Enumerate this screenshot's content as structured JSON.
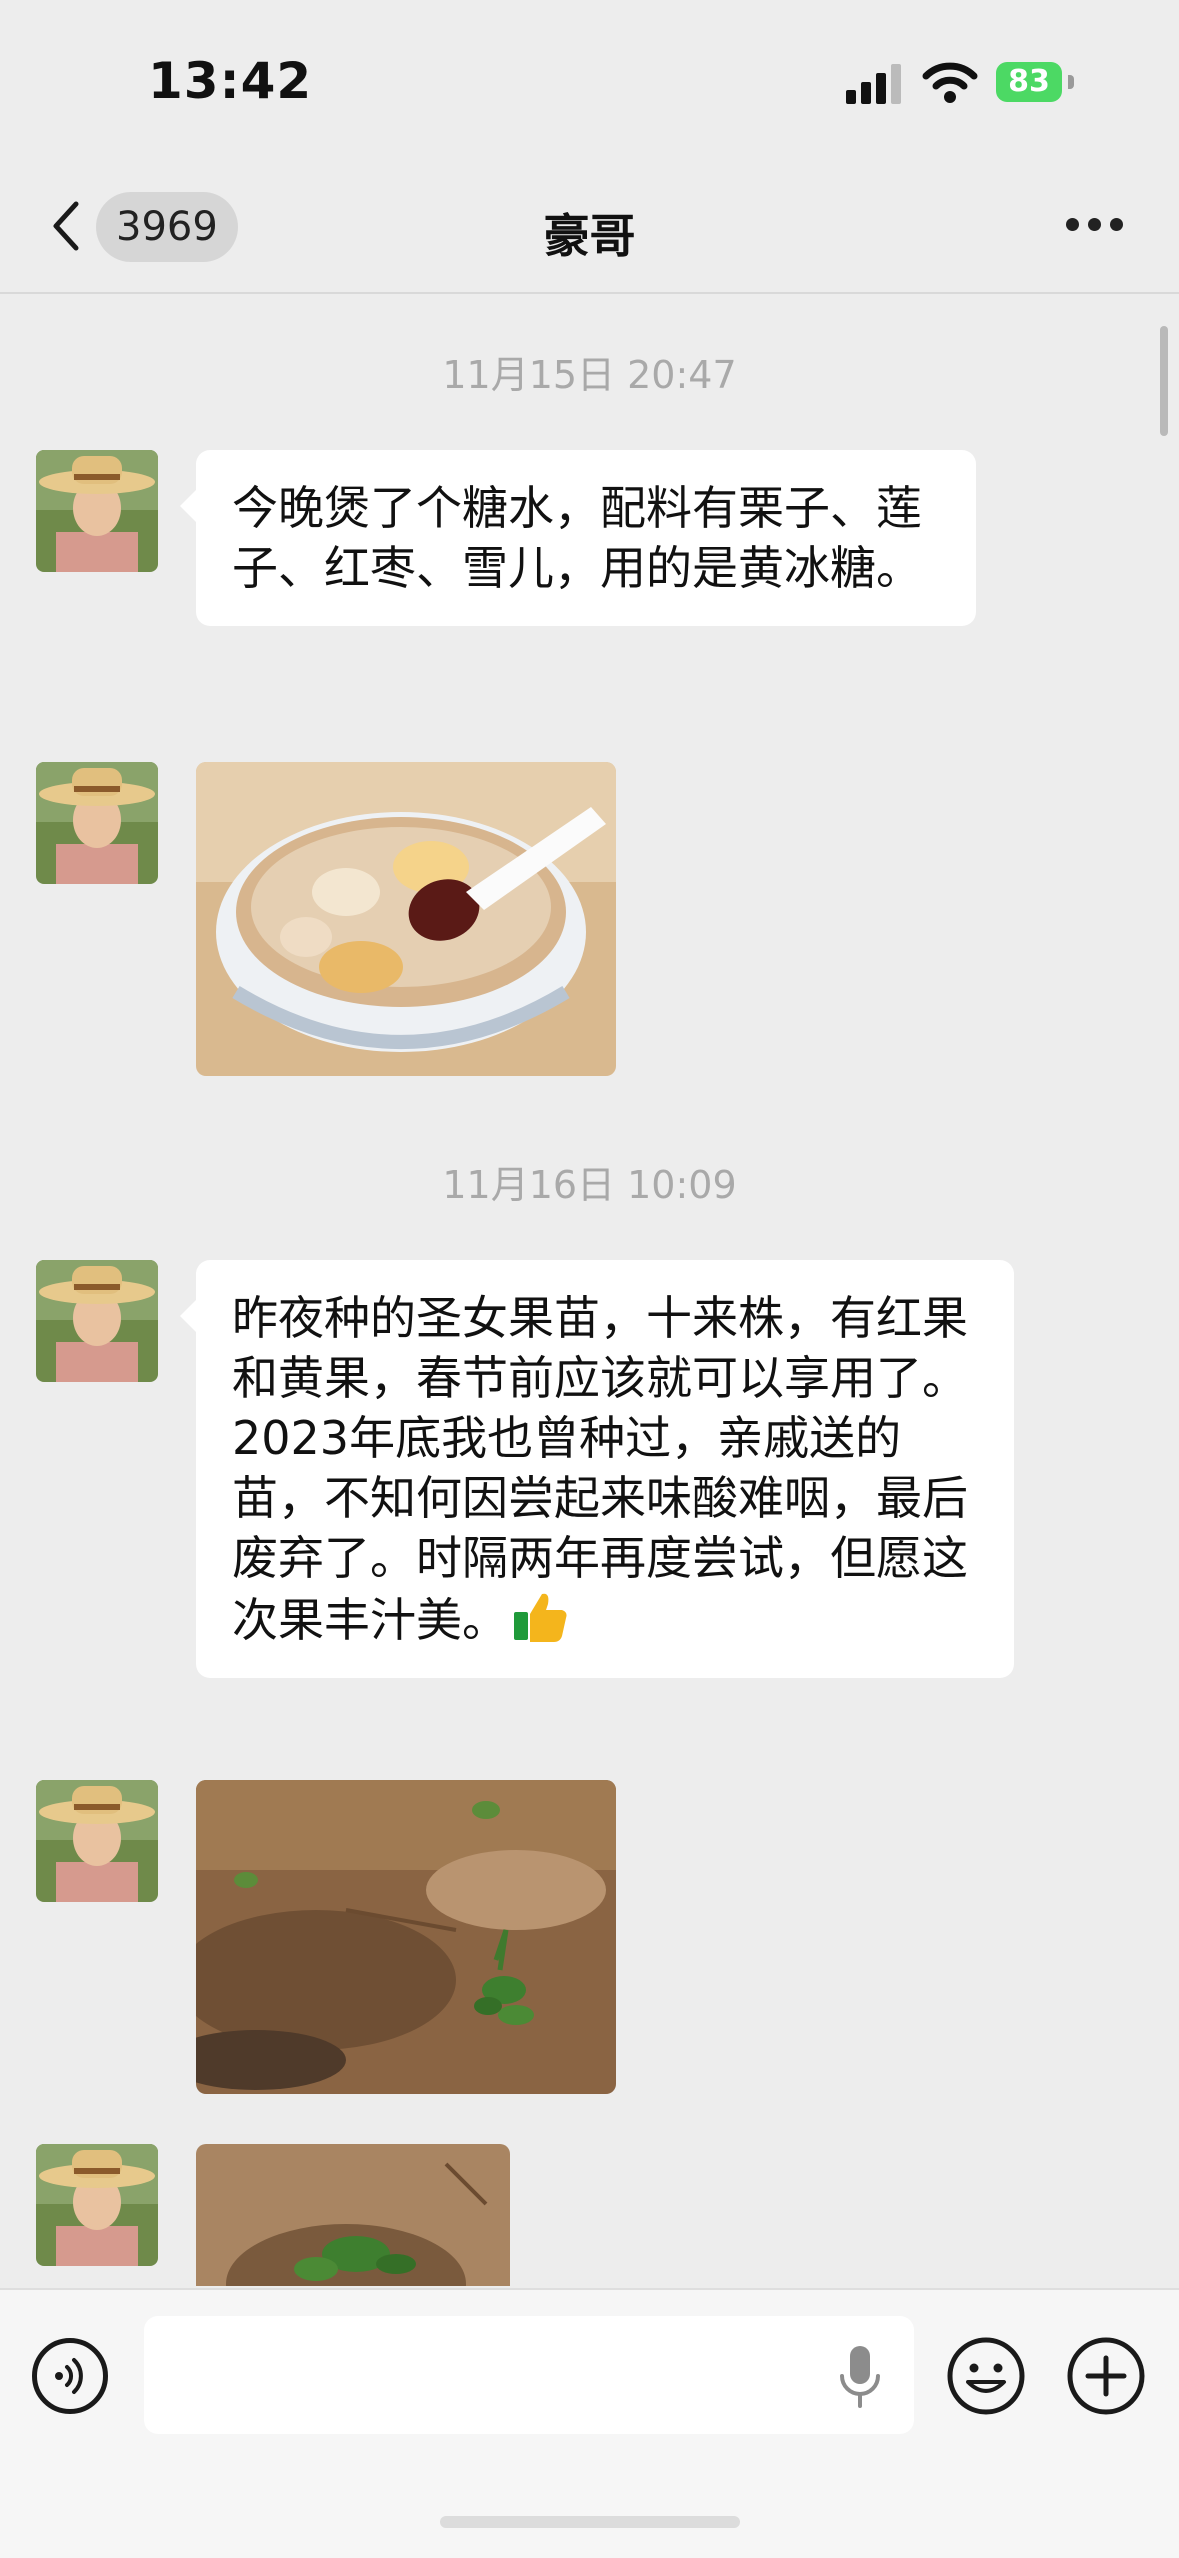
{
  "status_bar": {
    "time": "13:42",
    "battery": "83"
  },
  "header": {
    "back_count": "3969",
    "title": "豪哥"
  },
  "messages": {
    "ts1": "11月15日 20:47",
    "msg1": "今晚煲了个糖水，配料有栗子、莲子、红枣、雪儿，用的是黄冰糖。",
    "ts2": "11月16日 10:09",
    "msg2": "昨夜种的圣女果苗，十来株，有红果和黄果，春节前应该就可以享用了。2023年底我也曾种过，亲戚送的苗，不知何因尝起来味酸难咽，最后废弃了。时隔两年再度尝试，但愿这次果丰汁美。"
  },
  "icons": {
    "back": "chevron-left-icon",
    "more": "more-dots-icon",
    "thumb": "thumbs-up-emoji-icon",
    "voice": "voice-icon",
    "mic": "microphone-icon",
    "emoji": "emoji-icon",
    "plus": "plus-icon"
  },
  "colors": {
    "background": "#ededed",
    "bubble": "#ffffff",
    "battery": "#4cd964"
  }
}
